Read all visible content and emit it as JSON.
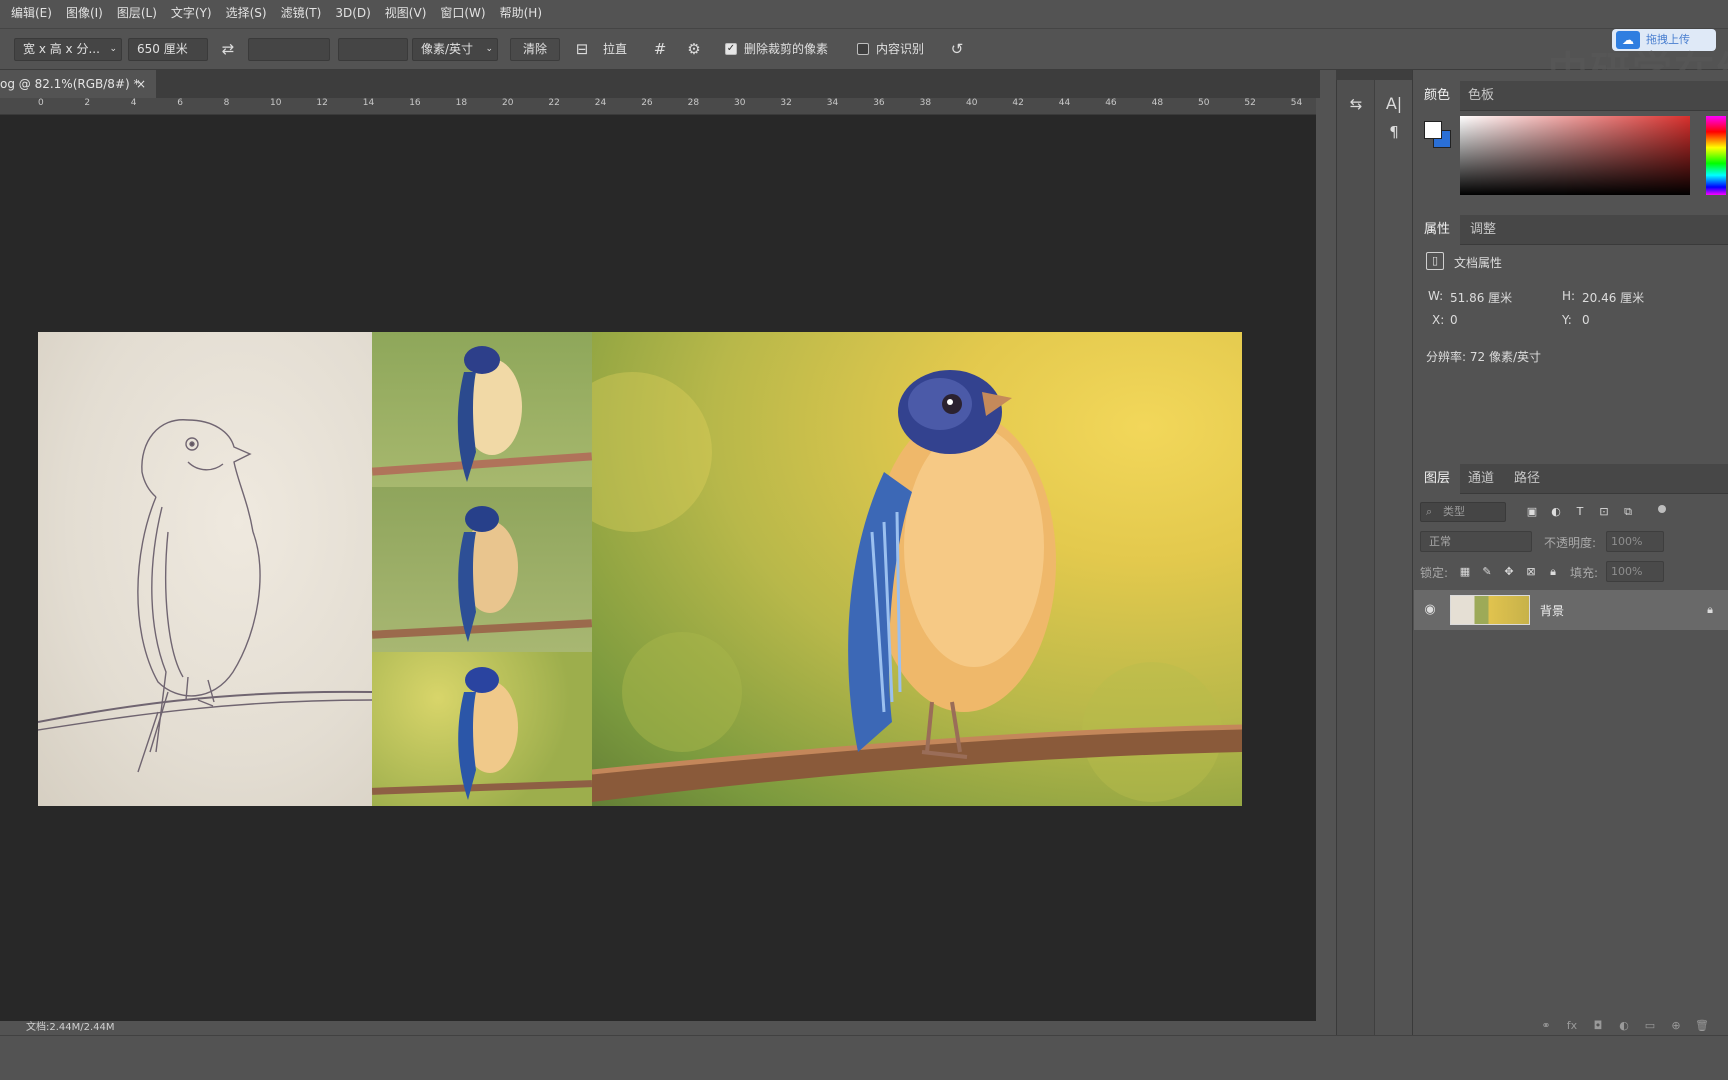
{
  "menu": [
    "编辑(E)",
    "图像(I)",
    "图层(L)",
    "文字(Y)",
    "选择(S)",
    "滤镜(T)",
    "3D(D)",
    "视图(V)",
    "窗口(W)",
    "帮助(H)"
  ],
  "options": {
    "ratio_select": "宽 x 高 x 分...",
    "width_value": "650 厘米",
    "height_value": "",
    "resolution_value": "",
    "unit_select": "像素/英寸",
    "clear_label": "清除",
    "straighten_label": "拉直",
    "delete_cropped_label": "删除裁剪的像素",
    "delete_cropped_checked": true,
    "content_aware_label": "内容识别",
    "content_aware_checked": false
  },
  "watermark": {
    "upload_label": "拖拽上传",
    "brand_text": "中研学在线"
  },
  "document": {
    "tab_title": "og @ 82.1%(RGB/8#) *",
    "tab_close": "×",
    "ruler_ticks": [
      "0",
      "2",
      "4",
      "6",
      "8",
      "10",
      "12",
      "14",
      "16",
      "18",
      "20",
      "22",
      "24",
      "26",
      "28",
      "30",
      "32",
      "34",
      "36",
      "38",
      "40",
      "42",
      "44",
      "46",
      "48",
      "50",
      "52",
      "54"
    ],
    "status_text": "文档:2.44M/2.44M"
  },
  "panels": {
    "color_tabs": [
      "颜色",
      "色板"
    ],
    "props_tabs": [
      "属性",
      "调整"
    ],
    "doc_props_title": "文档属性",
    "w_label": "W:",
    "w_value": "51.86 厘米",
    "h_label": "H:",
    "h_value": "20.46 厘米",
    "x_label": "X:",
    "x_value": "0",
    "y_label": "Y:",
    "y_value": "0",
    "resolution": "分辨率: 72 像素/英寸",
    "layers_tabs": [
      "图层",
      "通道",
      "路径"
    ],
    "filter_placeholder": "类型",
    "blend_mode": "正常",
    "opacity_label": "不透明度:",
    "opacity_value": "100%",
    "lock_label": "锁定:",
    "fill_label": "填充:",
    "fill_value": "100%",
    "layer_name": "背景"
  },
  "colors": {
    "accent_red": "#d8302d",
    "foreground": "#ffffff",
    "background": "#2a6fd6"
  }
}
